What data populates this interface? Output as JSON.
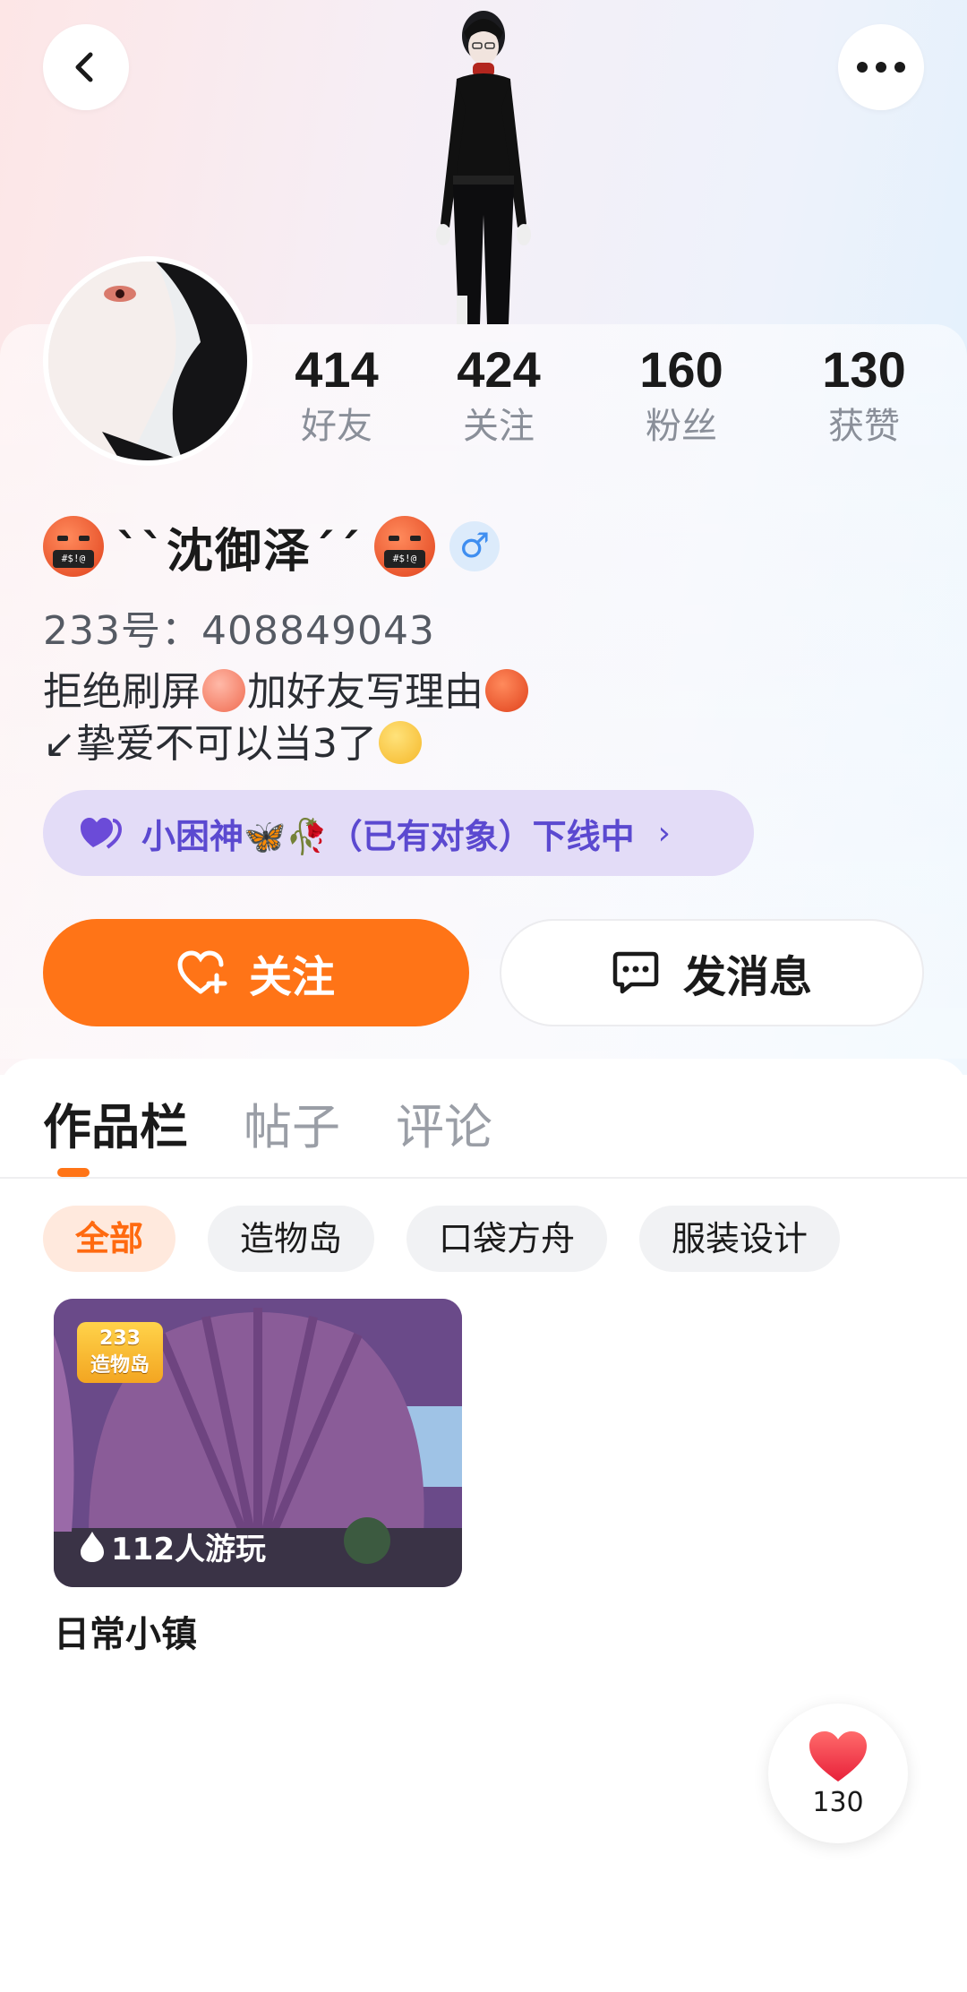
{
  "stats": [
    {
      "value": "414",
      "label": "好友"
    },
    {
      "value": "424",
      "label": "关注"
    },
    {
      "value": "160",
      "label": "粉丝"
    },
    {
      "value": "130",
      "label": "获赞"
    }
  ],
  "profile": {
    "name": "``沈御泽´´",
    "gender_symbol": "♂",
    "uid": "233号：408849043",
    "bio_line1_a": "拒绝刷屏",
    "bio_line1_b": "加好友写理由",
    "bio_line2": "↙挚爱不可以当3了",
    "status": "小困神🦋🥀（已有对象）下线中",
    "status_chevron": "›"
  },
  "actions": {
    "follow_label": "关注",
    "message_label": "发消息"
  },
  "tabs": [
    {
      "label": "作品栏",
      "active": true
    },
    {
      "label": "帖子",
      "active": false
    },
    {
      "label": "评论",
      "active": false
    }
  ],
  "filters": [
    {
      "label": "全部",
      "active": true
    },
    {
      "label": "造物岛",
      "active": false
    },
    {
      "label": "口袋方舟",
      "active": false
    },
    {
      "label": "服装设计",
      "active": false
    }
  ],
  "works": [
    {
      "title": "日常小镇",
      "plays": "112人游玩",
      "logo_line1": "233",
      "logo_line2": "造物岛"
    }
  ],
  "likes": {
    "count": "130"
  },
  "colors": {
    "accent": "#ff7417",
    "status_purple": "#5b49d0",
    "gender_blue": "#3f8ef0"
  },
  "icons": {
    "back": "chevron-left-icon",
    "more": "more-dots-icon",
    "follow": "heart-plus-icon",
    "message": "chat-bubble-icon",
    "like": "heart-icon"
  }
}
